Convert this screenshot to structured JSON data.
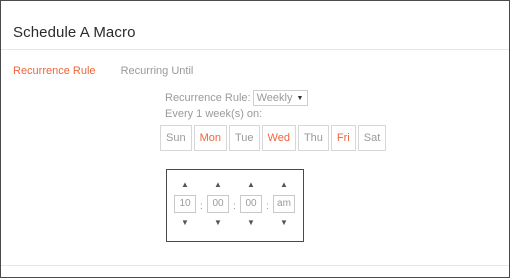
{
  "dialog": {
    "title": "Schedule A Macro"
  },
  "tabs": [
    {
      "label": "Recurrence Rule",
      "active": true
    },
    {
      "label": "Recurring Until",
      "active": false
    }
  ],
  "recurrence": {
    "label": "Recurrence Rule:",
    "selected": "Weekly",
    "every_text": "Every 1 week(s) on:"
  },
  "days": [
    {
      "label": "Sun",
      "selected": false
    },
    {
      "label": "Mon",
      "selected": true
    },
    {
      "label": "Tue",
      "selected": false
    },
    {
      "label": "Wed",
      "selected": true
    },
    {
      "label": "Thu",
      "selected": false
    },
    {
      "label": "Fri",
      "selected": true
    },
    {
      "label": "Sat",
      "selected": false
    }
  ],
  "time": {
    "hour": "10",
    "minute": "00",
    "second": "00",
    "period": "am",
    "separator": ":",
    "up_arrow": "▲",
    "down_arrow": "▼"
  },
  "colors": {
    "accent": "#f0643a",
    "muted_text": "#9a9a9a",
    "border": "#4a4a4a"
  }
}
